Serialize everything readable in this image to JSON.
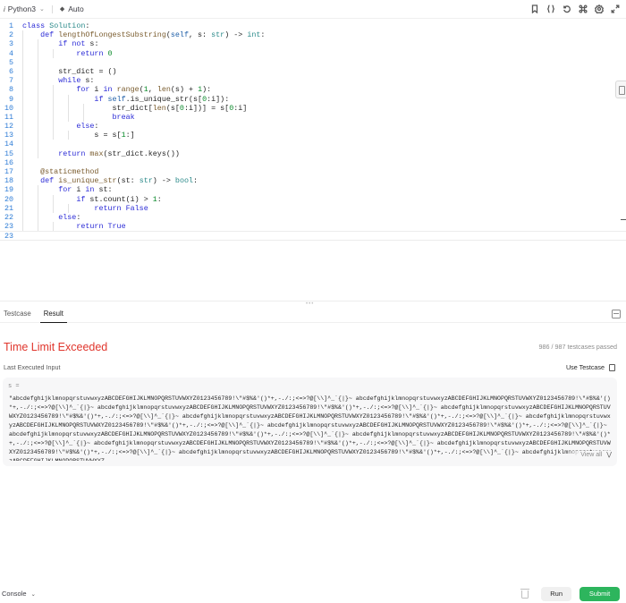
{
  "toolbar": {
    "language": "Python3",
    "mode": "Auto",
    "icons": [
      "bookmark-icon",
      "braces-icon",
      "reset-icon",
      "command-icon",
      "settings-icon",
      "expand-icon"
    ]
  },
  "editor": {
    "line_numbers": [
      "1",
      "2",
      "3",
      "4",
      "5",
      "6",
      "7",
      "8",
      "9",
      "10",
      "11",
      "12",
      "13",
      "14",
      "15",
      "16",
      "17",
      "18",
      "19",
      "20",
      "21",
      "22",
      "23"
    ],
    "current_line": 23
  },
  "tabs": {
    "testcase": "Testcase",
    "result": "Result"
  },
  "result": {
    "status": "Time Limit Exceeded",
    "passed_count": "986 / 987",
    "passed_label": "testcases passed",
    "last_executed_label": "Last Executed Input",
    "use_testcase_label": "Use Testcase",
    "variable_label": "s =",
    "input_value": "\"abcdefghijklmnopqrstuvwxyzABCDEFGHIJKLMNOPQRSTUVWXYZ0123456789!\\\"#$%&'()*+,-./:;<=>?@[\\\\]^_`{|}~ abcdefghijklmnopqrstuvwxyzABCDEFGHIJKLMNOPQRSTUVWXYZ0123456789!\\\"#$%&'()*+,-./:;<=>?@[\\\\]^_`{|}~ abcdefghijklmnopqrstuvwxyzABCDEFGHIJKLMNOPQRSTUVWXYZ0123456789!\\\"#$%&'()*+,-./:;<=>?@[\\\\]^_`{|}~ abcdefghijklmnopqrstuvwxyzABCDEFGHIJKLMNOPQRSTUVWXYZ0123456789!\\\"#$%&'()*+,-./:;<=>?@[\\\\]^_`{|}~ abcdefghijklmnopqrstuvwxyzABCDEFGHIJKLMNOPQRSTUVWXYZ0123456789!\\\"#$%&'()*+,-./:;<=>?@[\\\\]^_`{|}~ abcdefghijklmnopqrstuvwxyzABCDEFGHIJKLMNOPQRSTUVWXYZ0123456789!\\\"#$%&'()*+,-./:;<=>?@[\\\\]^_`{|}~ abcdefghijklmnopqrstuvwxyzABCDEFGHIJKLMNOPQRSTUVWXYZ0123456789!\\\"#$%&'()*+,-./:;<=>?@[\\\\]^_`{|}~ abcdefghijklmnopqrstuvwxyzABCDEFGHIJKLMNOPQRSTUVWXYZ0123456789!\\\"#$%&'()*+,-./:;<=>?@[\\\\]^_`{|}~ abcdefghijklmnopqrstuvwxyzABCDEFGHIJKLMNOPQRSTUVWXYZ0123456789!\\\"#$%&'()*+,-./:;<=>?@[\\\\]^_`{|}~ abcdefghijklmnopqrstuvwxyzABCDEFGHIJKLMNOPQRSTUVWXYZ0123456789!\\\"#$%&'()*+,-./:;<=>?@[\\\\]^_`{|}~ abcdefghijklmnopqrstuvwxyzABCDEFGHIJKLMNOPQRSTUVWXYZ0123456789!\\\"#$%&'()*+,-./:;<=>?@[\\\\]^_`{|}~ abcdefghijklmnopqrstuvwxyzABCDEFGHIJKLMNOPQRSTUVWXYZ0123456789!\\\"#$%&'()*+,-./:;<=>?@[\\\\]^_`{|}~ abcdefghijklmnopqrstuvwxyzABCDEFGHIJKLMNOPQRSTUVWXYZ",
    "view_all_label": "View all"
  },
  "footer": {
    "console_label": "Console",
    "run_label": "Run",
    "submit_label": "Submit"
  },
  "colors": {
    "error": "#e0362d",
    "submit": "#2db55d",
    "line_number": "#2d7cd6"
  }
}
